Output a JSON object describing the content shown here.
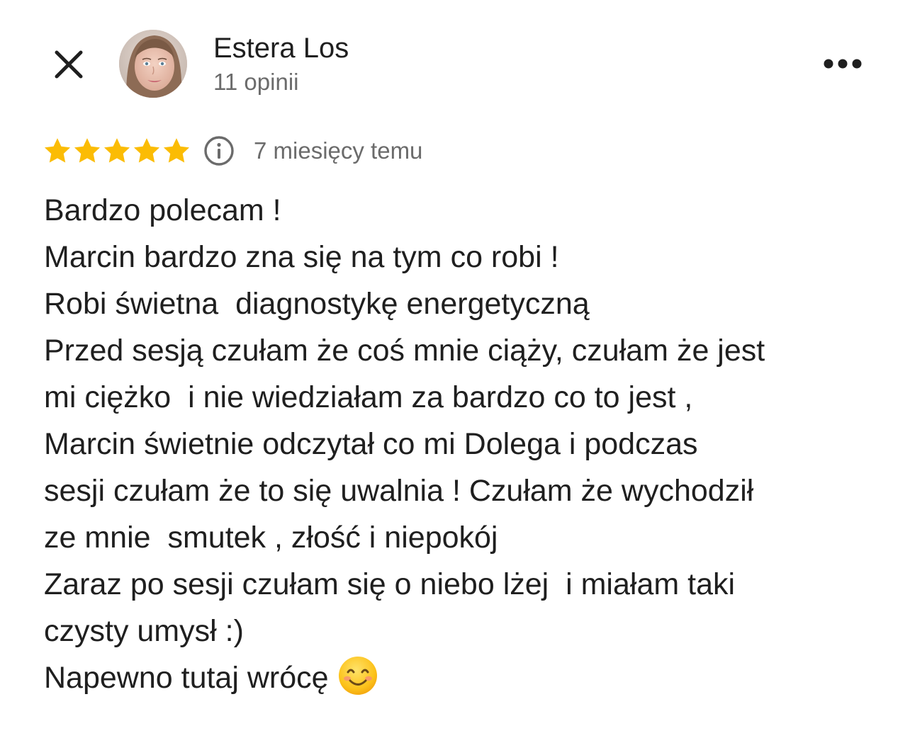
{
  "header": {
    "close_icon": "close-icon",
    "author_name": "Estera Los",
    "review_count": "11 opinii",
    "more_icon": "more-horizontal-icon"
  },
  "rating": {
    "stars": 5,
    "max_stars": 5,
    "star_color": "#fbbc04",
    "info_icon": "info-icon",
    "time_ago": "7 miesięcy temu"
  },
  "review": {
    "lines": [
      "Bardzo polecam !",
      "Marcin bardzo zna się na tym co robi !",
      "Robi świetna  diagnostykę energetyczną",
      "Przed sesją czułam że coś mnie ciąży, czułam że jest",
      "mi ciężko  i nie wiedziałam za bardzo co to jest ,",
      "Marcin świetnie odczytał co mi Dolega i podczas",
      "sesji czułam że to się uwalnia ! Czułam że wychodził",
      "ze mnie  smutek , złość i niepokój",
      "Zaraz po sesji czułam się o niebo lżej  i miałam taki",
      "czysty umysł :)",
      "Napewno tutaj wrócę"
    ],
    "emoji_icon": "smiling-face-emoji-icon"
  },
  "colors": {
    "text_primary": "#1f1f1f",
    "text_secondary": "#6b6b6b",
    "star": "#fbbc04"
  }
}
